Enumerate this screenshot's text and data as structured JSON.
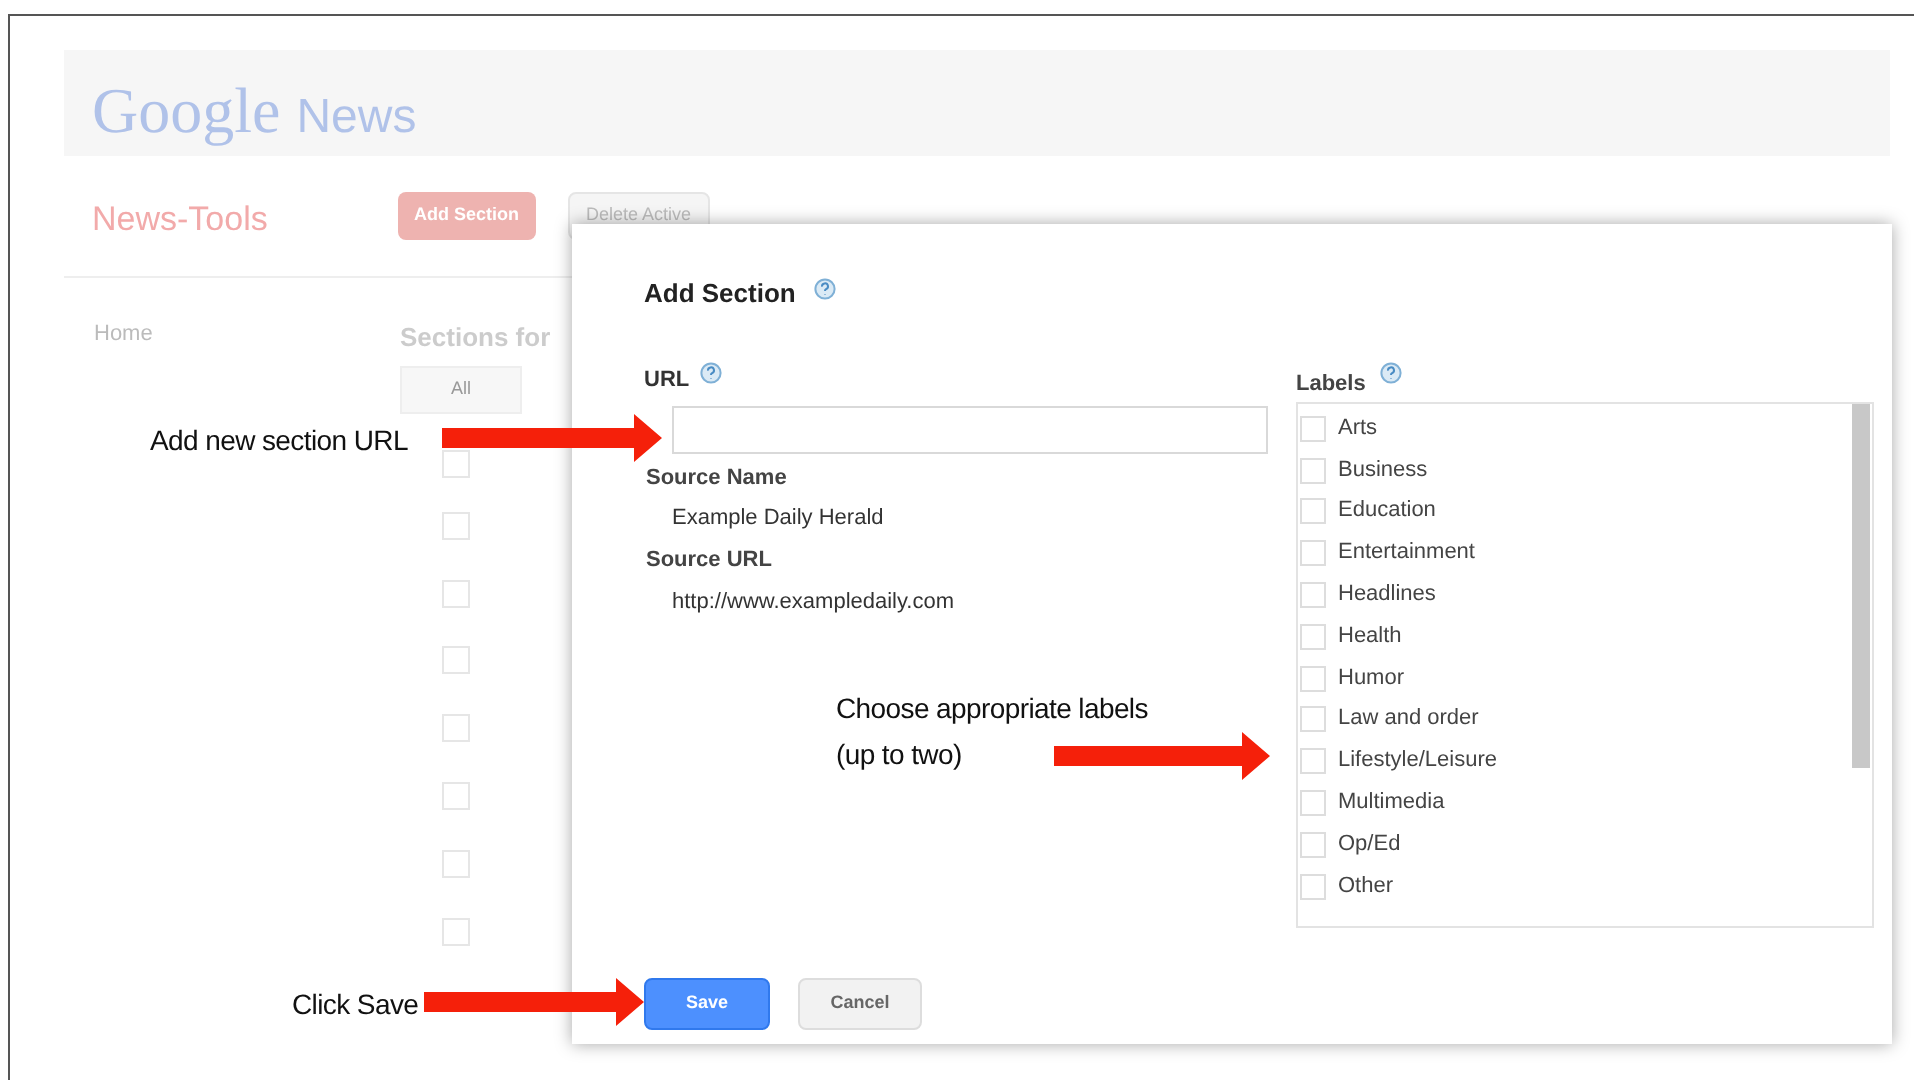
{
  "page": {
    "logo": {
      "brand": "Google",
      "product": "News"
    },
    "app_title": "News-Tools",
    "buttons": [
      {
        "label": "Add Section",
        "kind": "primary"
      },
      {
        "label": "Delete Active",
        "kind": "secondary"
      }
    ],
    "nav": [
      "Home"
    ],
    "sections_heading": "Sections for",
    "filter_button": "All",
    "section_rows": [
      {
        "checked": false
      },
      {
        "checked": false
      },
      {
        "checked": false
      },
      {
        "checked": false
      },
      {
        "checked": false
      },
      {
        "checked": false
      },
      {
        "checked": false
      },
      {
        "checked": false
      }
    ]
  },
  "dialog": {
    "title": "Add Section",
    "url_label": "URL",
    "source_name_label": "Source Name",
    "source_name": "Example Daily Herald",
    "source_url_label": "Source URL",
    "source_url": "http://www.exampledaily.com",
    "labels_heading": "Labels",
    "labels": [
      {
        "label": "Arts",
        "checked": false
      },
      {
        "label": "Business",
        "checked": false
      },
      {
        "label": "Education",
        "checked": false
      },
      {
        "label": "Entertainment",
        "checked": false
      },
      {
        "label": "Headlines",
        "checked": false
      },
      {
        "label": "Health",
        "checked": false
      },
      {
        "label": "Humor",
        "checked": false
      },
      {
        "label": "Law and order",
        "checked": false
      },
      {
        "label": "Lifestyle/Leisure",
        "checked": false
      },
      {
        "label": "Multimedia",
        "checked": false
      },
      {
        "label": "Op/Ed",
        "checked": false
      },
      {
        "label": "Other",
        "checked": false
      }
    ],
    "buttons": [
      {
        "label": "Save",
        "kind": "primary"
      },
      {
        "label": "Cancel",
        "kind": "secondary"
      }
    ]
  },
  "annotations": [
    {
      "text": "Add new section URL"
    },
    {
      "text": "Choose appropriate labels\n(up to two)"
    },
    {
      "text": "Click Save"
    }
  ]
}
